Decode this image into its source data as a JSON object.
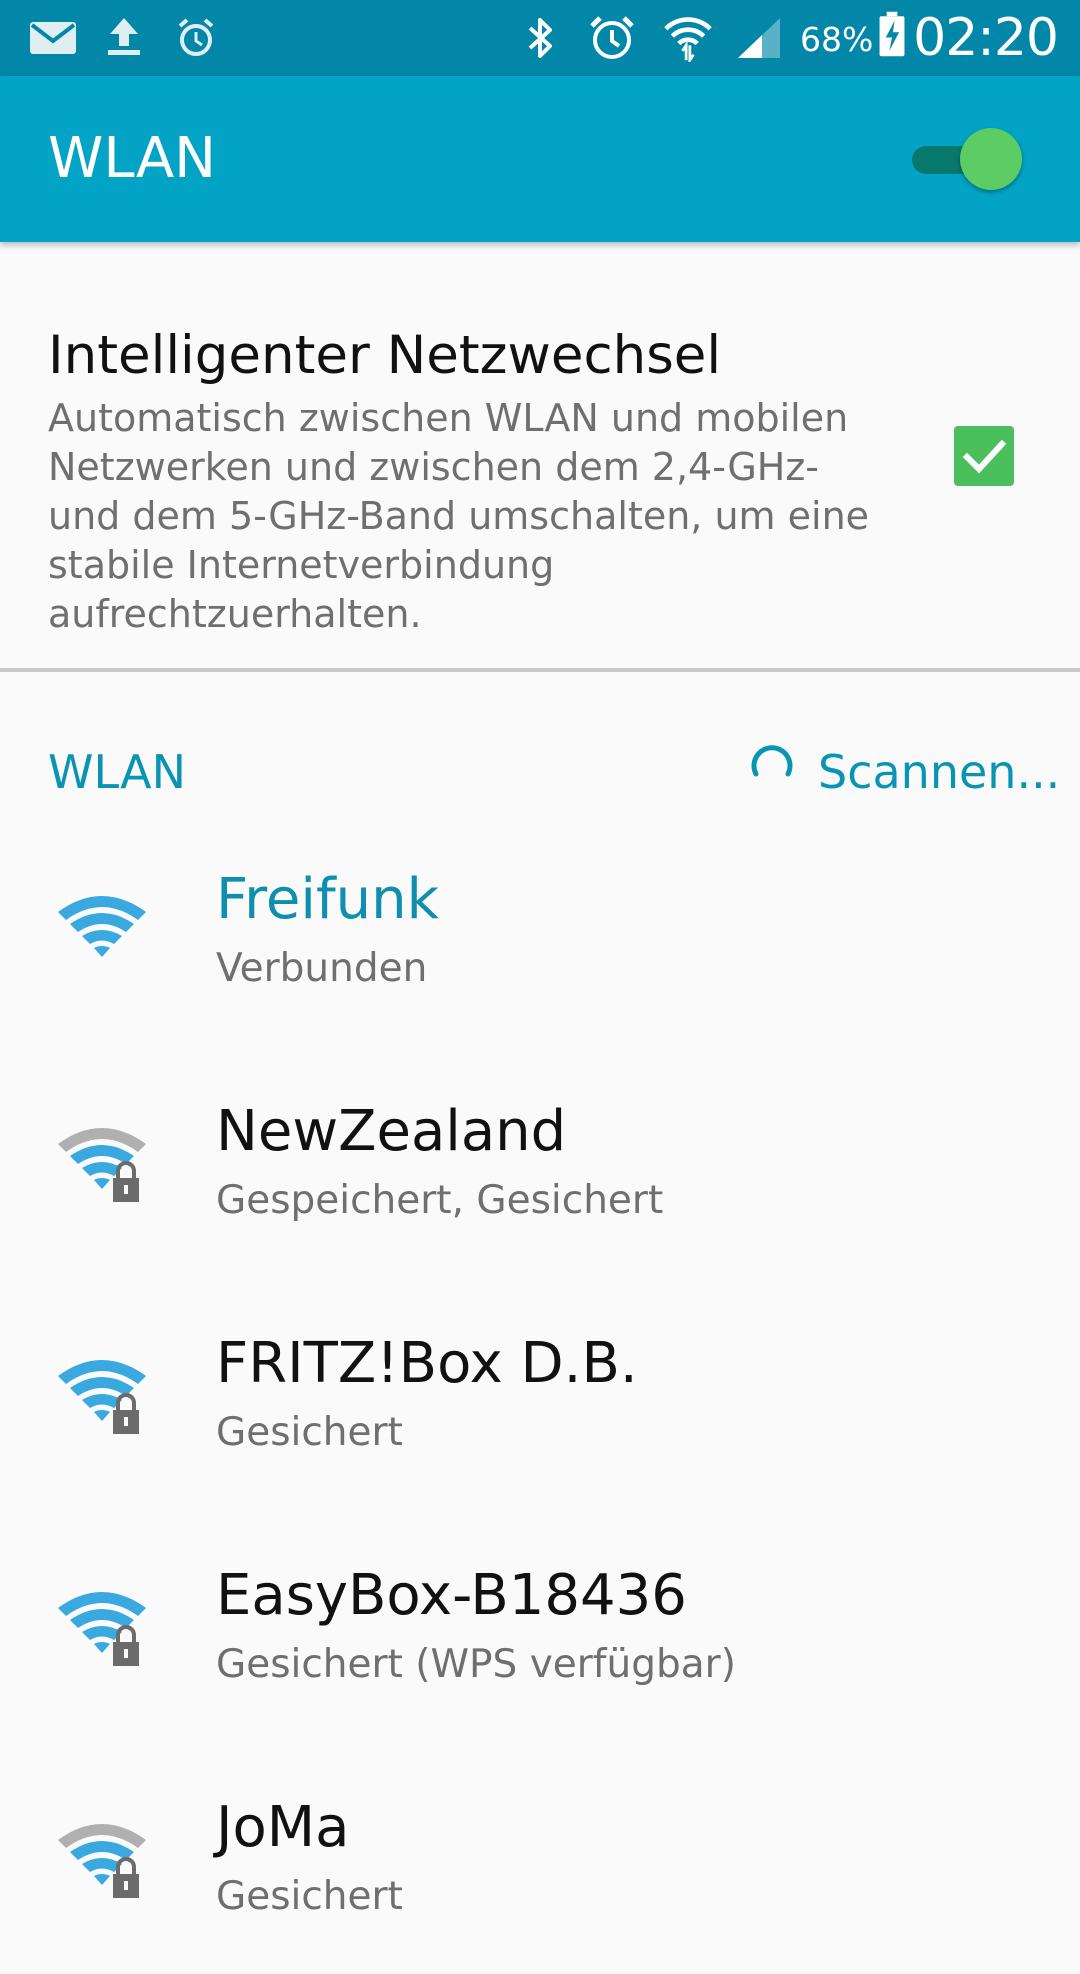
{
  "status_bar": {
    "battery_percent": "68%",
    "time": "02:20",
    "icons": [
      "mail-icon",
      "upload-icon",
      "alarm-clock-icon",
      "bluetooth-icon",
      "alarm-icon",
      "wifi-status-icon",
      "cell-signal-icon",
      "battery-charging-icon"
    ]
  },
  "action_bar": {
    "title": "WLAN",
    "wlan_enabled": true
  },
  "smart_switch": {
    "title": "Intelligenter Netzwechsel",
    "description": "Automatisch zwischen WLAN und mobilen Netzwerken und zwischen dem 2,4-GHz- und dem 5-GHz-Band umschalten, um eine stabile Internetverbindung aufrechtzuerhalten.",
    "checked": true
  },
  "networks_header": {
    "label": "WLAN",
    "scan_label": "Scannen..."
  },
  "networks": [
    {
      "ssid": "Freifunk",
      "status": "Verbunden",
      "connected": true,
      "secured": false,
      "icon": "wifi-icon"
    },
    {
      "ssid": "NewZealand",
      "status": "Gespeichert, Gesichert",
      "connected": false,
      "secured": true,
      "icon": "wifi-locked-icon"
    },
    {
      "ssid": "FRITZ!Box D.B.",
      "status": "Gesichert",
      "connected": false,
      "secured": true,
      "icon": "wifi-locked-icon"
    },
    {
      "ssid": "EasyBox-B18436",
      "status": "Gesichert (WPS verfügbar)",
      "connected": false,
      "secured": true,
      "icon": "wifi-locked-icon"
    },
    {
      "ssid": "JoMa",
      "status": "Gesichert",
      "connected": false,
      "secured": true,
      "icon": "wifi-locked-icon"
    }
  ],
  "colors": {
    "status_bar": "#0287a8",
    "action_bar": "#03a3c5",
    "accent": "#0a94b4",
    "switch_on": "#5ccd65",
    "checkbox": "#4cbf5d",
    "wifi_strong": "#3aa9e0",
    "wifi_weak": "#b0b0b0"
  }
}
